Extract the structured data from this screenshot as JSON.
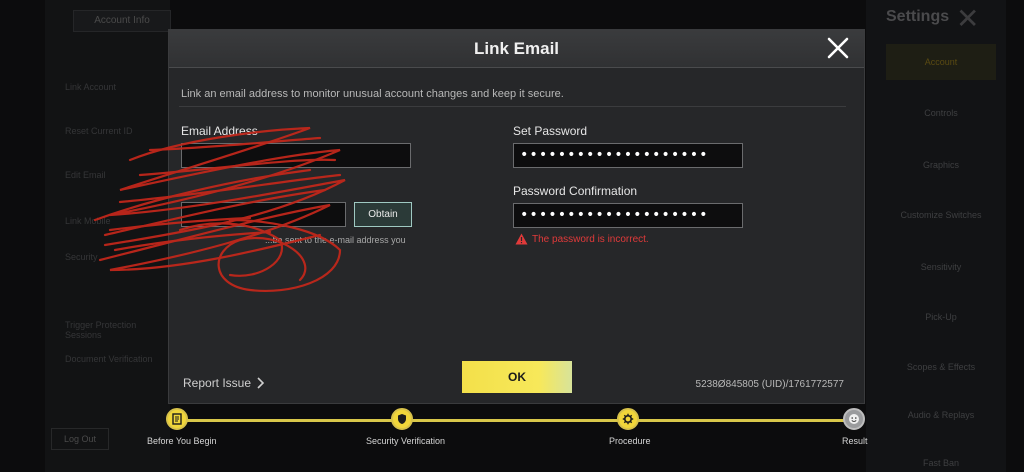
{
  "background": {
    "left_button": "Account Info",
    "left_rows": [
      "Link Account",
      "Reset Current ID",
      "Edit Email",
      "Link Mobile",
      "Security",
      "Trigger Protection Sessions",
      "Document Verification"
    ],
    "logout_label": "Log Out",
    "right_title": "Settings",
    "right_tabs": [
      "Account",
      "Controls",
      "Graphics",
      "Customize Switches",
      "Sensitivity",
      "Pick-Up",
      "Scopes & Effects",
      "Audio & Replays",
      "Fast Ban"
    ]
  },
  "dialog": {
    "title": "Link Email",
    "description": "Link an email address to monitor unusual account changes and keep it secure.",
    "email_label": "Email Address",
    "email_value": "",
    "code_value": "",
    "obtain_label": "Obtain",
    "hint": "...be sent to the e-mail address you",
    "set_password_label": "Set Password",
    "set_password_value": "••••••••••••••••••••",
    "confirm_label": "Password Confirmation",
    "confirm_value": "••••••••••••••••••••",
    "error_text": "The password is incorrect.",
    "report_label": "Report Issue",
    "ok_label": "OK",
    "uid_text": "5238Ø845805 (UID)/1761772577"
  },
  "stepper": {
    "steps": [
      {
        "label": "Before You Begin",
        "state": "done"
      },
      {
        "label": "Security Verification",
        "state": "done"
      },
      {
        "label": "Procedure",
        "state": "current"
      },
      {
        "label": "Result",
        "state": "pending"
      }
    ]
  },
  "colors": {
    "accent_yellow": "#f1d63a",
    "error_red": "#e03a3a",
    "obtain_border": "#9fc9c2"
  }
}
